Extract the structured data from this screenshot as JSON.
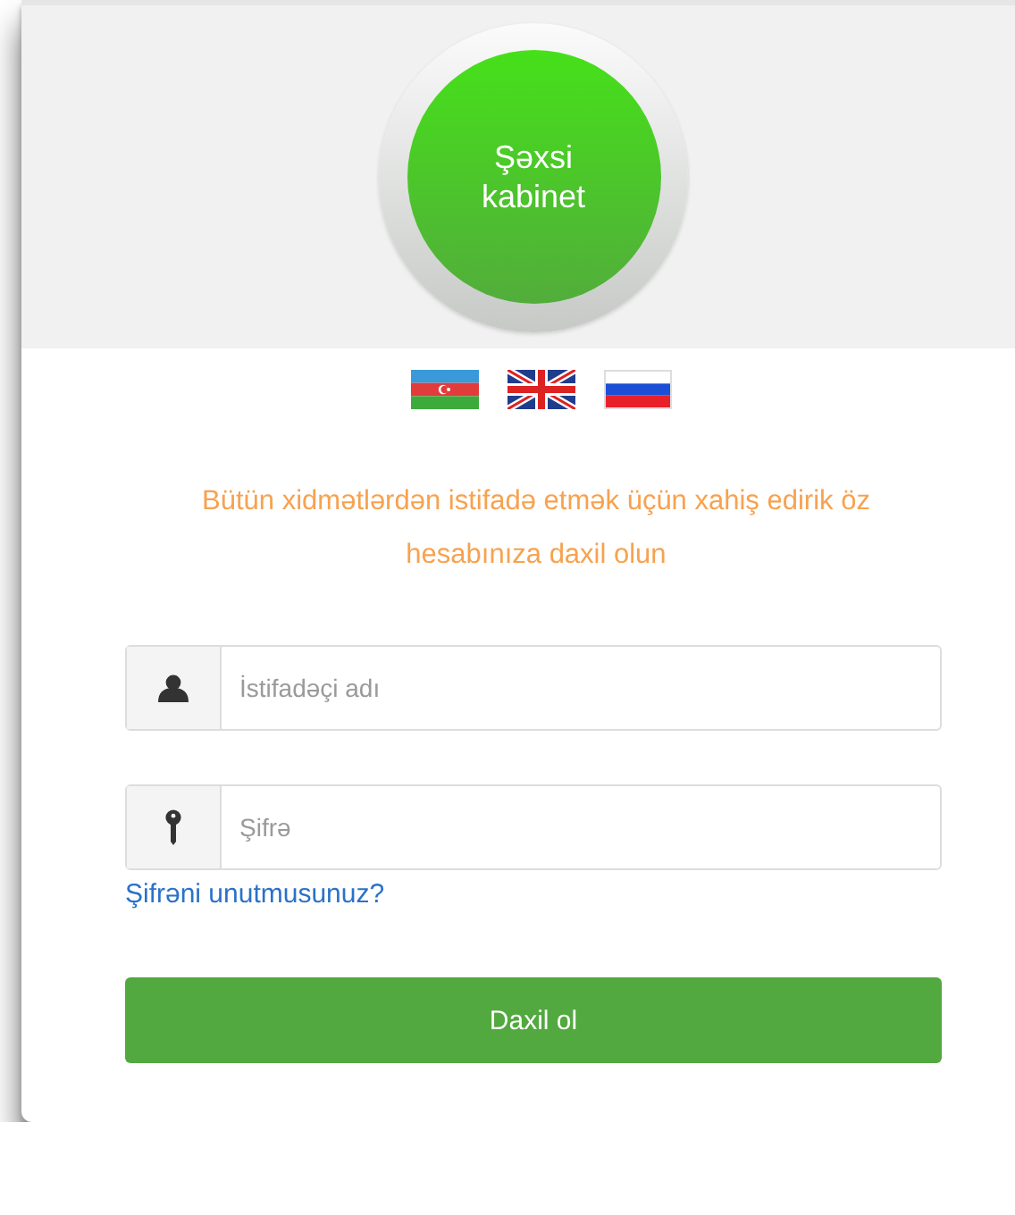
{
  "badge": {
    "text": "Şəxsi kabinet"
  },
  "languages": [
    {
      "kind": "az"
    },
    {
      "kind": "en"
    },
    {
      "kind": "ru"
    }
  ],
  "message": "Bütün xidmətlərdən istifadə etmək üçün xahiş edirik öz hesabınıza daxil olun",
  "fields": [
    {
      "kind": "user",
      "placeholder": "İstifadəçi adı"
    },
    {
      "kind": "key",
      "placeholder": "Şifrə"
    }
  ],
  "forgot_link": "Şifrəni unutmusunuz?",
  "submit": "Daxil ol"
}
